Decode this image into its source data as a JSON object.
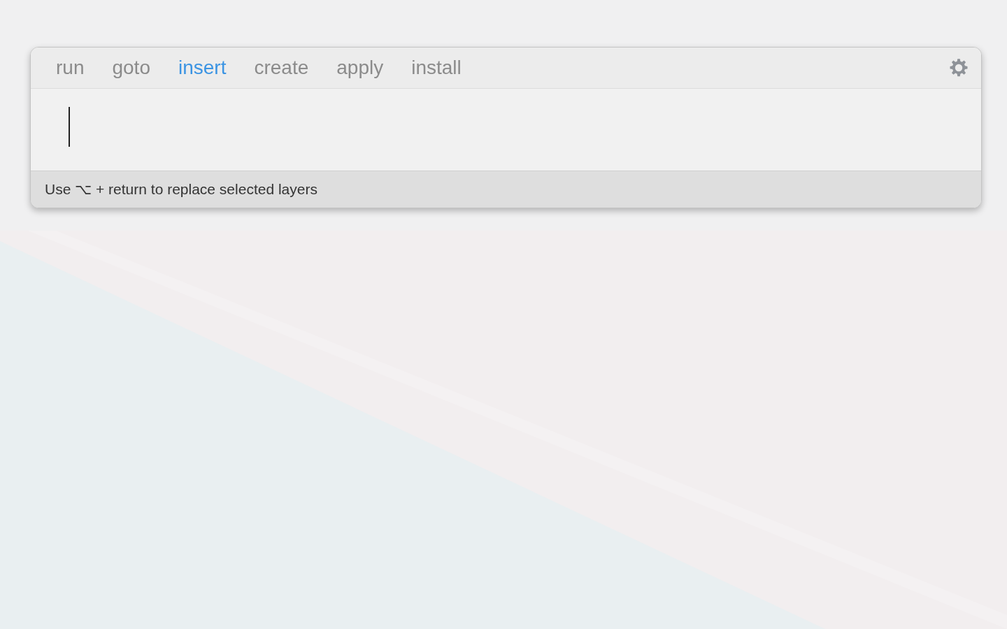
{
  "tabs": [
    {
      "label": "run",
      "selected": false
    },
    {
      "label": "goto",
      "selected": false
    },
    {
      "label": "insert",
      "selected": true
    },
    {
      "label": "create",
      "selected": false
    },
    {
      "label": "apply",
      "selected": false
    },
    {
      "label": "install",
      "selected": false
    }
  ],
  "input": {
    "focused": true
  },
  "status_bar": {
    "hint": "Use ⌥ + return to replace selected layers"
  }
}
